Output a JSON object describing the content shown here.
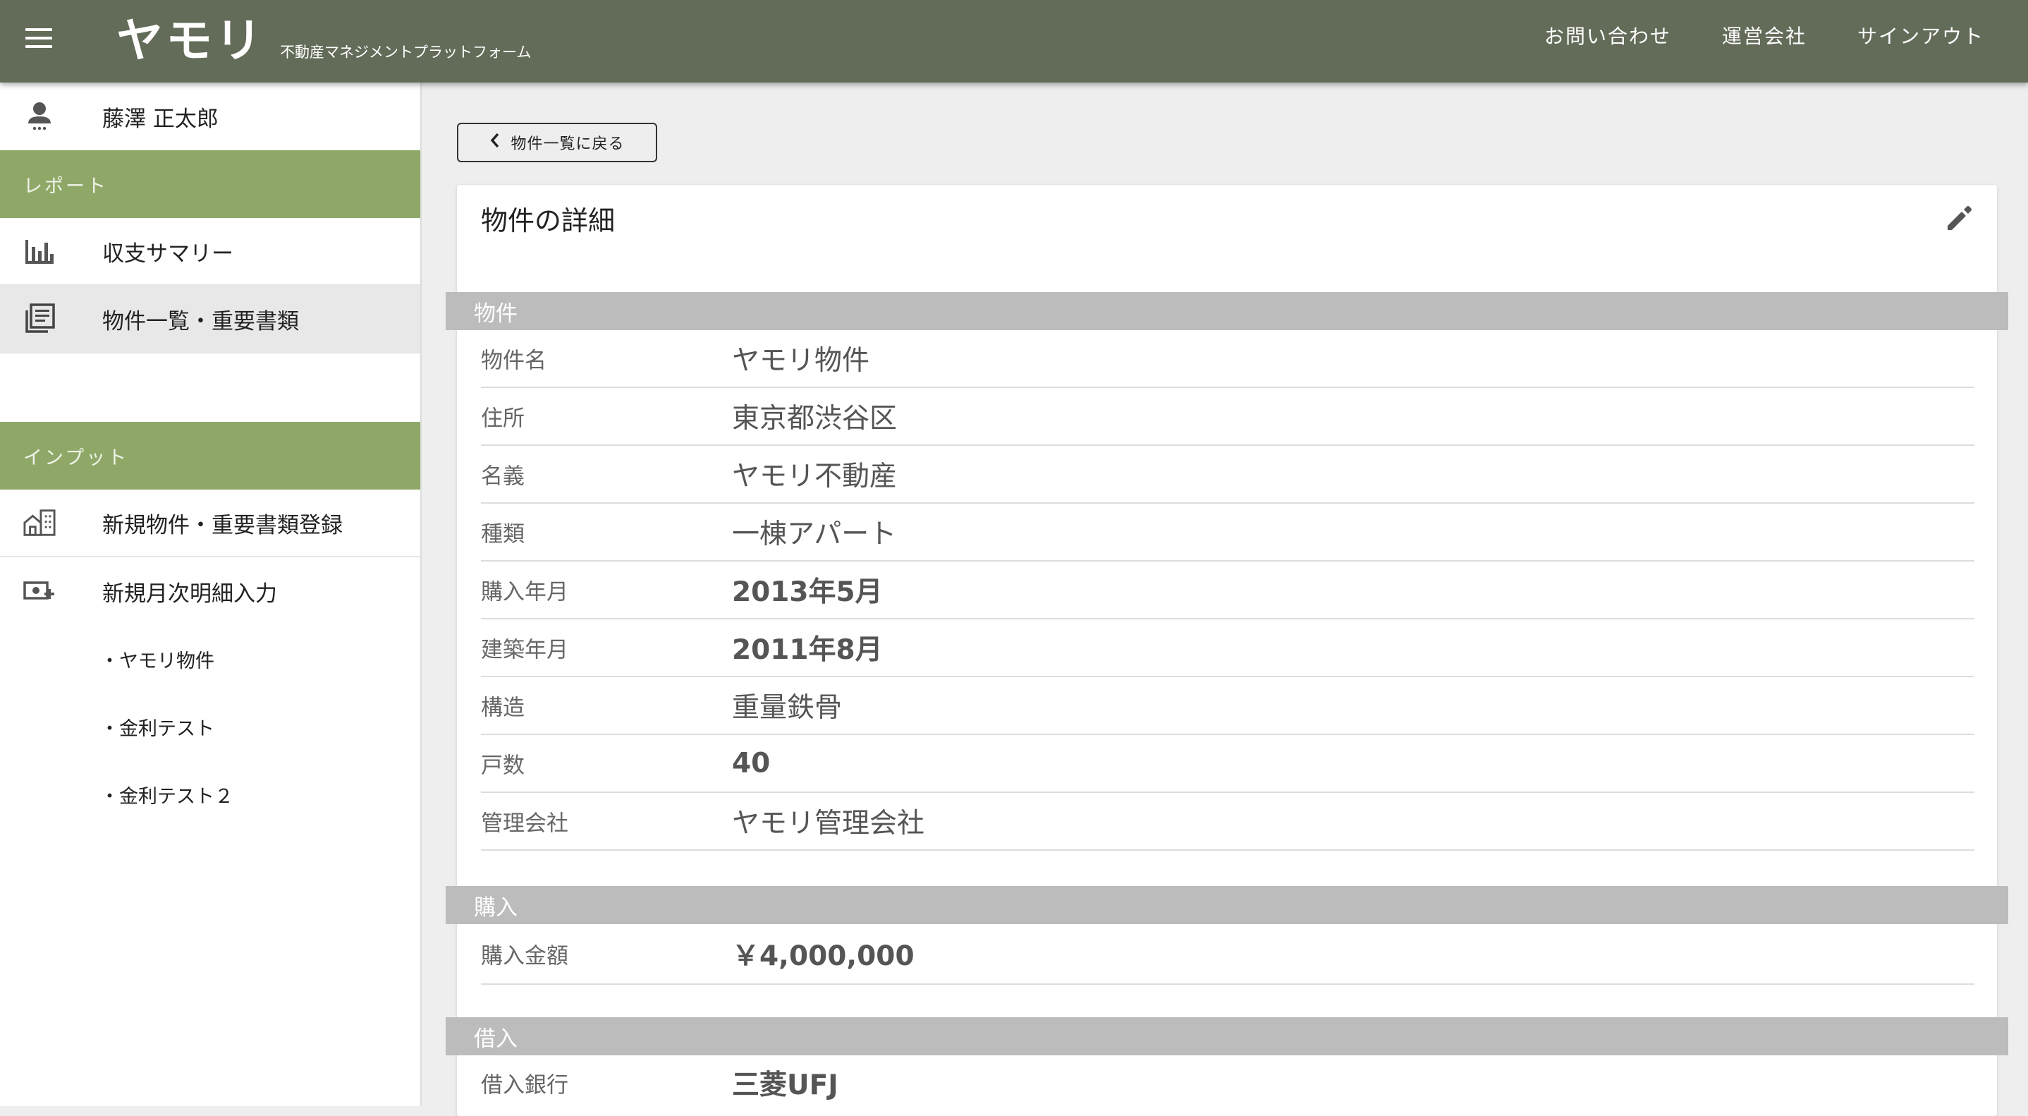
{
  "header": {
    "logo_text": "ヤモリ",
    "logo_subtitle": "不動産マネジメントプラットフォーム",
    "nav": [
      "お問い合わせ",
      "運営会社",
      "サインアウト"
    ]
  },
  "sidebar": {
    "user_name": "藤澤 正太郎",
    "section_report": "レポート",
    "report_items": [
      "収支サマリー",
      "物件一覧・重要書類"
    ],
    "section_input": "インプット",
    "input_items": [
      "新規物件・重要書類登録",
      "新規月次明細入力"
    ],
    "sub_items": [
      "・ヤモリ物件",
      "・金利テスト",
      "・金利テスト２"
    ]
  },
  "main": {
    "back_label": "物件一覧に戻る",
    "card_title": "物件の詳細",
    "sections": {
      "property": "物件",
      "purchase": "購入",
      "loan": "借入"
    },
    "property_rows": [
      {
        "key": "物件名",
        "value": "ヤモリ物件"
      },
      {
        "key": "住所",
        "value": "東京都渋谷区"
      },
      {
        "key": "名義",
        "value": "ヤモリ不動産"
      },
      {
        "key": "種類",
        "value": "一棟アパート"
      },
      {
        "key": "購入年月",
        "value": "2013年5月"
      },
      {
        "key": "建築年月",
        "value": "2011年8月"
      },
      {
        "key": "構造",
        "value": "重量鉄骨"
      },
      {
        "key": "戸数",
        "value": "40"
      },
      {
        "key": "管理会社",
        "value": "ヤモリ管理会社"
      }
    ],
    "purchase_rows": [
      {
        "key": "購入金額",
        "value": "￥4,000,000"
      }
    ],
    "loan_rows": [
      {
        "key": "借入銀行",
        "value": "三菱UFJ"
      }
    ]
  },
  "colors": {
    "header_bg": "#636b59",
    "section_green": "#8fa868",
    "section_grey": "#bcbcbc"
  }
}
